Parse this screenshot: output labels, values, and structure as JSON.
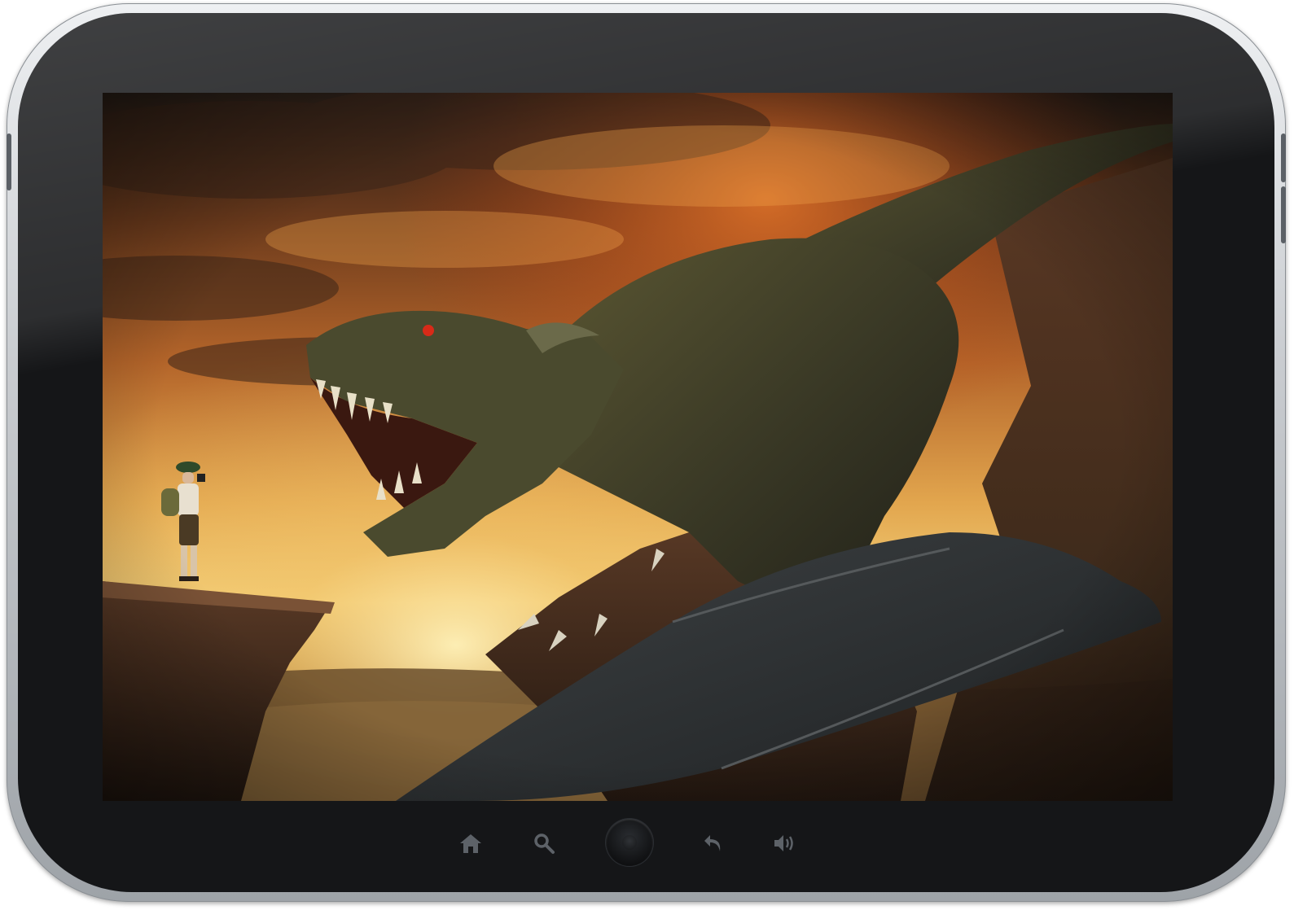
{
  "device": {
    "type": "tablet",
    "colors": {
      "bezel": "#151618",
      "frame": "#c9ccd0",
      "nav_icon": "#5d6268"
    }
  },
  "screen": {
    "content": "fantasy-artwork-wallpaper"
  },
  "navbar": {
    "items": [
      {
        "icon": "home-icon"
      },
      {
        "icon": "search-icon"
      },
      {
        "icon": "home-button"
      },
      {
        "icon": "back-icon"
      },
      {
        "icon": "volume-icon"
      }
    ]
  }
}
